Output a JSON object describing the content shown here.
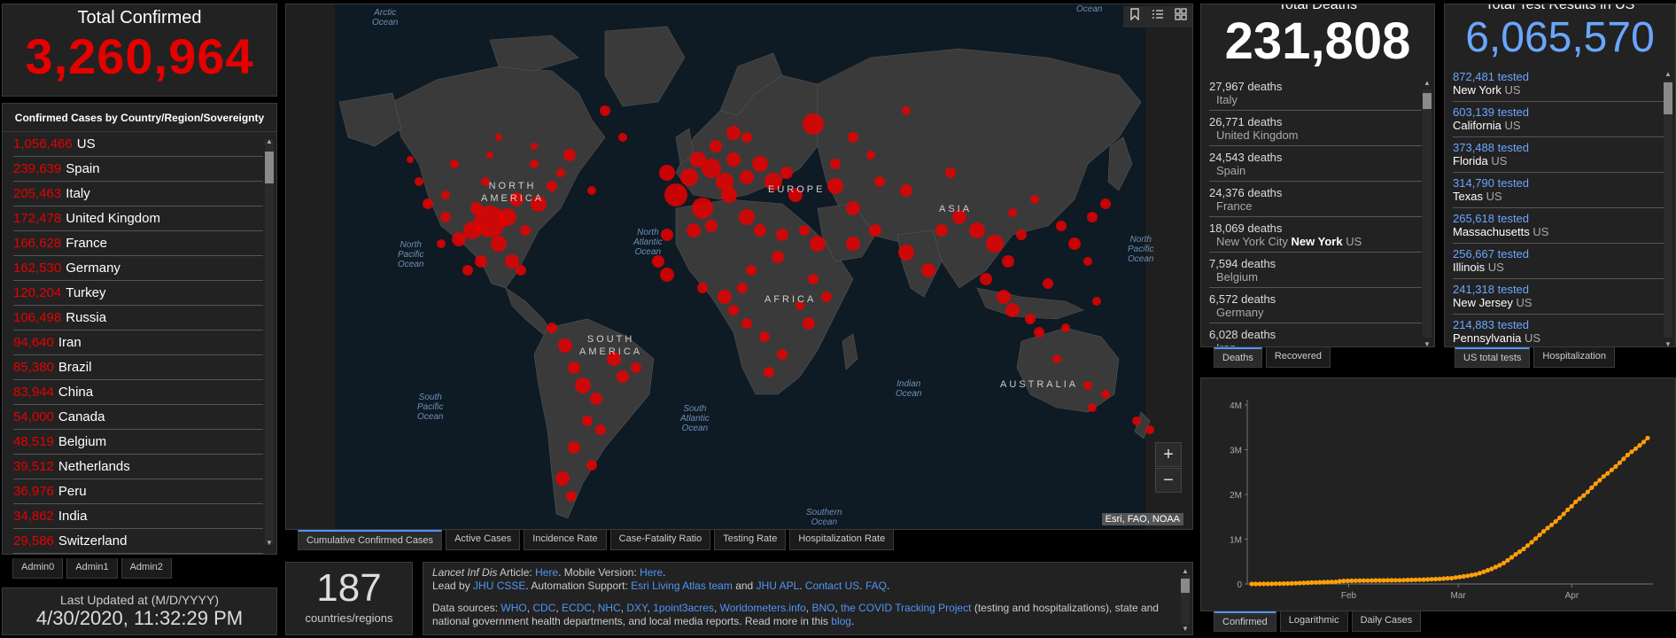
{
  "total_confirmed": {
    "title": "Total Confirmed",
    "value": "3,260,964"
  },
  "country_panel": {
    "header": "Confirmed Cases by Country/Region/Sovereignty",
    "items": [
      {
        "count": "1,056,466",
        "name": "US"
      },
      {
        "count": "239,639",
        "name": "Spain"
      },
      {
        "count": "205,463",
        "name": "Italy"
      },
      {
        "count": "172,478",
        "name": "United Kingdom"
      },
      {
        "count": "166,628",
        "name": "France"
      },
      {
        "count": "162,530",
        "name": "Germany"
      },
      {
        "count": "120,204",
        "name": "Turkey"
      },
      {
        "count": "106,498",
        "name": "Russia"
      },
      {
        "count": "94,640",
        "name": "Iran"
      },
      {
        "count": "85,380",
        "name": "Brazil"
      },
      {
        "count": "83,944",
        "name": "China"
      },
      {
        "count": "54,000",
        "name": "Canada"
      },
      {
        "count": "48,519",
        "name": "Belgium"
      },
      {
        "count": "39,512",
        "name": "Netherlands"
      },
      {
        "count": "36,976",
        "name": "Peru"
      },
      {
        "count": "34,862",
        "name": "India"
      },
      {
        "count": "29,586",
        "name": "Switzerland"
      }
    ],
    "tabs": [
      "Admin0",
      "Admin1",
      "Admin2"
    ]
  },
  "last_updated": {
    "label": "Last Updated at (M/D/YYYY)",
    "value": "4/30/2020, 11:32:29 PM"
  },
  "map": {
    "ocean_labels": {
      "arctic": "Arctic\nOcean",
      "north_pacific": "North\nPacific\nOcean",
      "north_atlantic": "North\nAtlantic\nOcean",
      "north_pacific_east": "North\nPacific\nOcean",
      "south_pacific": "South\nPacific\nOcean",
      "south_atlantic": "South\nAtlantic\nOcean",
      "indian": "Indian\nOcean",
      "southern": "Southern\nOcean",
      "arctic_right": "Ocean"
    },
    "continent_labels": {
      "north_america": "NORTH\nAMERICA",
      "europe": "EUROPE",
      "asia": "ASIA",
      "africa": "AFRICA",
      "south_america": "SOUTH\nAMERICA",
      "australia": "AUSTRALIA"
    },
    "attribution": "Esri, FAO, NOAA",
    "zoom_in": "+",
    "zoom_out": "−",
    "tabs": [
      "Cumulative Confirmed Cases",
      "Active Cases",
      "Incidence Rate",
      "Case-Fatality Ratio",
      "Testing Rate",
      "Hospitalization Rate"
    ],
    "bubble_color": "#e60000",
    "tool_icons": [
      "bookmark-icon",
      "list-icon",
      "qr-icon"
    ]
  },
  "count_panel": {
    "value": "187",
    "label": "countries/regions"
  },
  "info": {
    "line1_journal": "Lancet Inf Dis",
    "line1_article": " Article: ",
    "line1_here1": "Here",
    "line1_mobile": ". Mobile Version: ",
    "line1_here2": "Here",
    "line1_end": ".",
    "line2_lead": "Lead by ",
    "line2_jhu": "JHU CSSE",
    "line2_auto": ". Automation Support: ",
    "line2_esri": "Esri Living Atlas team",
    "line2_and": " and ",
    "line2_apl": "JHU APL",
    "line2_dot": ". ",
    "line2_contact": "Contact US",
    "line2_dot2": ". ",
    "line2_faq": "FAQ",
    "line2_end": ".",
    "line3_prefix": "Data sources: ",
    "line3_sources": [
      "WHO",
      "CDC",
      "ECDC",
      "NHC",
      "DXY",
      "1point3acres",
      "Worldometers.info",
      "BNO",
      "the COVID Tracking Project"
    ],
    "line3_suffix": " (testing and hospitalizations), state and national government health departments, and local media reports.  Read more in this ",
    "line3_blog": "blog",
    "line3_end": "."
  },
  "deaths": {
    "title": "Total Deaths",
    "value": "231,808",
    "items": [
      {
        "count": "27,967 deaths",
        "place": "Italy",
        "bold": "",
        "suffix": ""
      },
      {
        "count": "26,771 deaths",
        "place": "United Kingdom",
        "bold": "",
        "suffix": ""
      },
      {
        "count": "24,543 deaths",
        "place": "Spain",
        "bold": "",
        "suffix": ""
      },
      {
        "count": "24,376 deaths",
        "place": "France",
        "bold": "",
        "suffix": ""
      },
      {
        "count": "18,069 deaths",
        "place": "New York City ",
        "bold": "New York",
        "suffix": " US"
      },
      {
        "count": "7,594 deaths",
        "place": "Belgium",
        "bold": "",
        "suffix": ""
      },
      {
        "count": "6,572 deaths",
        "place": "Germany",
        "bold": "",
        "suffix": ""
      },
      {
        "count": "6,028 deaths",
        "place": "Iran",
        "bold": "",
        "suffix": ""
      }
    ],
    "tabs": [
      "Deaths",
      "Recovered"
    ]
  },
  "tests": {
    "title": "Total Test Results in US",
    "value": "6,065,570",
    "items": [
      {
        "count": "872,481 tested",
        "state": "New York",
        "country": " US"
      },
      {
        "count": "603,139 tested",
        "state": "California",
        "country": " US"
      },
      {
        "count": "373,488 tested",
        "state": "Florida",
        "country": " US"
      },
      {
        "count": "314,790 tested",
        "state": "Texas",
        "country": " US"
      },
      {
        "count": "265,618 tested",
        "state": "Massachusetts",
        "country": " US"
      },
      {
        "count": "256,667 tested",
        "state": "Illinois",
        "country": " US"
      },
      {
        "count": "241,318 tested",
        "state": "New Jersey",
        "country": " US"
      },
      {
        "count": "214,883 tested",
        "state": "Pennsylvania",
        "country": " US"
      }
    ],
    "tabs": [
      "US total tests",
      "Hospitalization"
    ]
  },
  "chart_tabs": [
    "Confirmed",
    "Logarithmic",
    "Daily Cases"
  ],
  "chart_data": {
    "type": "line",
    "title": "",
    "xlabel": "",
    "ylabel": "",
    "x_ticks": [
      "Feb",
      "Mar",
      "Apr"
    ],
    "y_ticks": [
      "0",
      "1M",
      "2M",
      "3M",
      "4M"
    ],
    "ylim": [
      0,
      4000000
    ],
    "color": "#ff9f0a",
    "series": [
      {
        "values": [
          555,
          654,
          941,
          1434,
          2118,
          2927,
          5578,
          6166,
          8234,
          9927,
          12038,
          16787,
          19881,
          23892,
          27635,
          30794,
          34391,
          37120,
          40150,
          42762,
          44802,
          45221,
          60368,
          66885,
          69030,
          71224,
          73258,
          75136,
          75639,
          76197,
          76819,
          78572,
          78958,
          79561,
          80406,
          81388,
          82746,
          84112,
          86011,
          88369,
          90306,
          92840,
          95120,
          97886,
          101801,
          105847,
          109821,
          113590,
          118620,
          125875,
          128352,
          145205,
          156101,
          167454,
          181574,
          197102,
          214821,
          242570,
          272208,
          304507,
          336953,
          378235,
          418045,
          467653,
          529591,
          593291,
          660706,
          720117,
          782365,
          857487,
          932605,
          1013466,
          1095917,
          1176060,
          1249754,
          1321481,
          1396476,
          1479804,
          1565278,
          1657526,
          1735650,
          1834721,
          1904838,
          1976191,
          2056054,
          2152437,
          2240190,
          2317759,
          2401378,
          2472259,
          2549123,
          2624184,
          2708885,
          2795729,
          2881140,
          2955033,
          3023722,
          3097229,
          3172287,
          3260964
        ]
      }
    ]
  }
}
